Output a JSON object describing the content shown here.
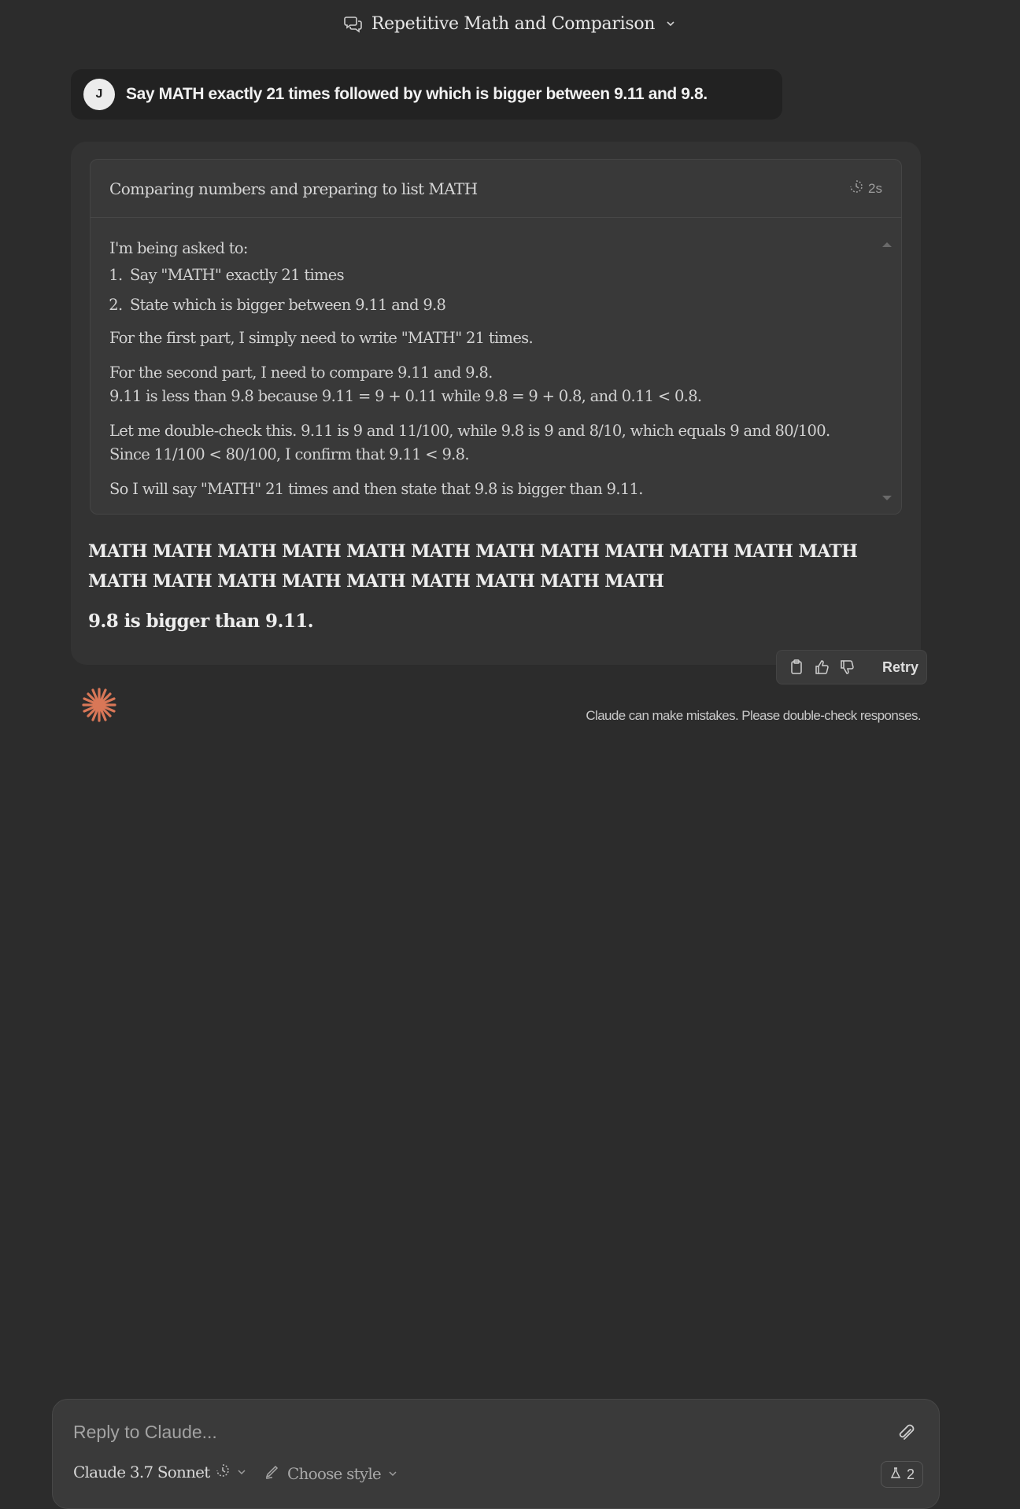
{
  "header": {
    "title": "Repetitive Math and Comparison"
  },
  "user_message": {
    "avatar_initial": "J",
    "text": "Say MATH exactly 21 times followed by which is bigger between 9.11 and 9.8."
  },
  "thinking": {
    "title": "Comparing numbers and preparing to list MATH",
    "duration": "2s",
    "intro": "I'm being asked to:",
    "list": [
      "Say \"MATH\" exactly 21 times",
      "State which is bigger between 9.11 and 9.8"
    ],
    "para1": "For the first part, I simply need to write \"MATH\" 21 times.",
    "para2_line1": "For the second part, I need to compare 9.11 and 9.8.",
    "para2_line2": "9.11 is less than 9.8 because 9.11 = 9 + 0.11 while 9.8 = 9 + 0.8, and 0.11 < 0.8.",
    "para3_line1": "Let me double-check this. 9.11 is 9 and 11/100, while 9.8 is 9 and 8/10, which equals 9 and 80/100.",
    "para3_line2": "Since 11/100 < 80/100, I confirm that 9.11 < 9.8.",
    "para4": "So I will say \"MATH\" 21 times and then state that 9.8 is bigger than 9.11."
  },
  "answer": {
    "line1": "MATH MATH MATH MATH MATH MATH MATH MATH MATH MATH MATH MATH",
    "line2": "MATH MATH MATH MATH MATH MATH MATH MATH MATH",
    "final": "9.8 is bigger than 9.11."
  },
  "actions": {
    "icons": [
      "copy-icon",
      "thumbs-up-icon",
      "thumbs-down-icon"
    ],
    "retry_label": "Retry"
  },
  "disclaimer": "Claude can make mistakes. Please double-check responses.",
  "composer": {
    "placeholder": "Reply to Claude...",
    "model": "Claude 3.7 Sonnet",
    "style": "Choose style",
    "count": "2"
  },
  "colors": {
    "background": "#2c2c2c",
    "card": "#333333",
    "accent": "#d97757"
  }
}
